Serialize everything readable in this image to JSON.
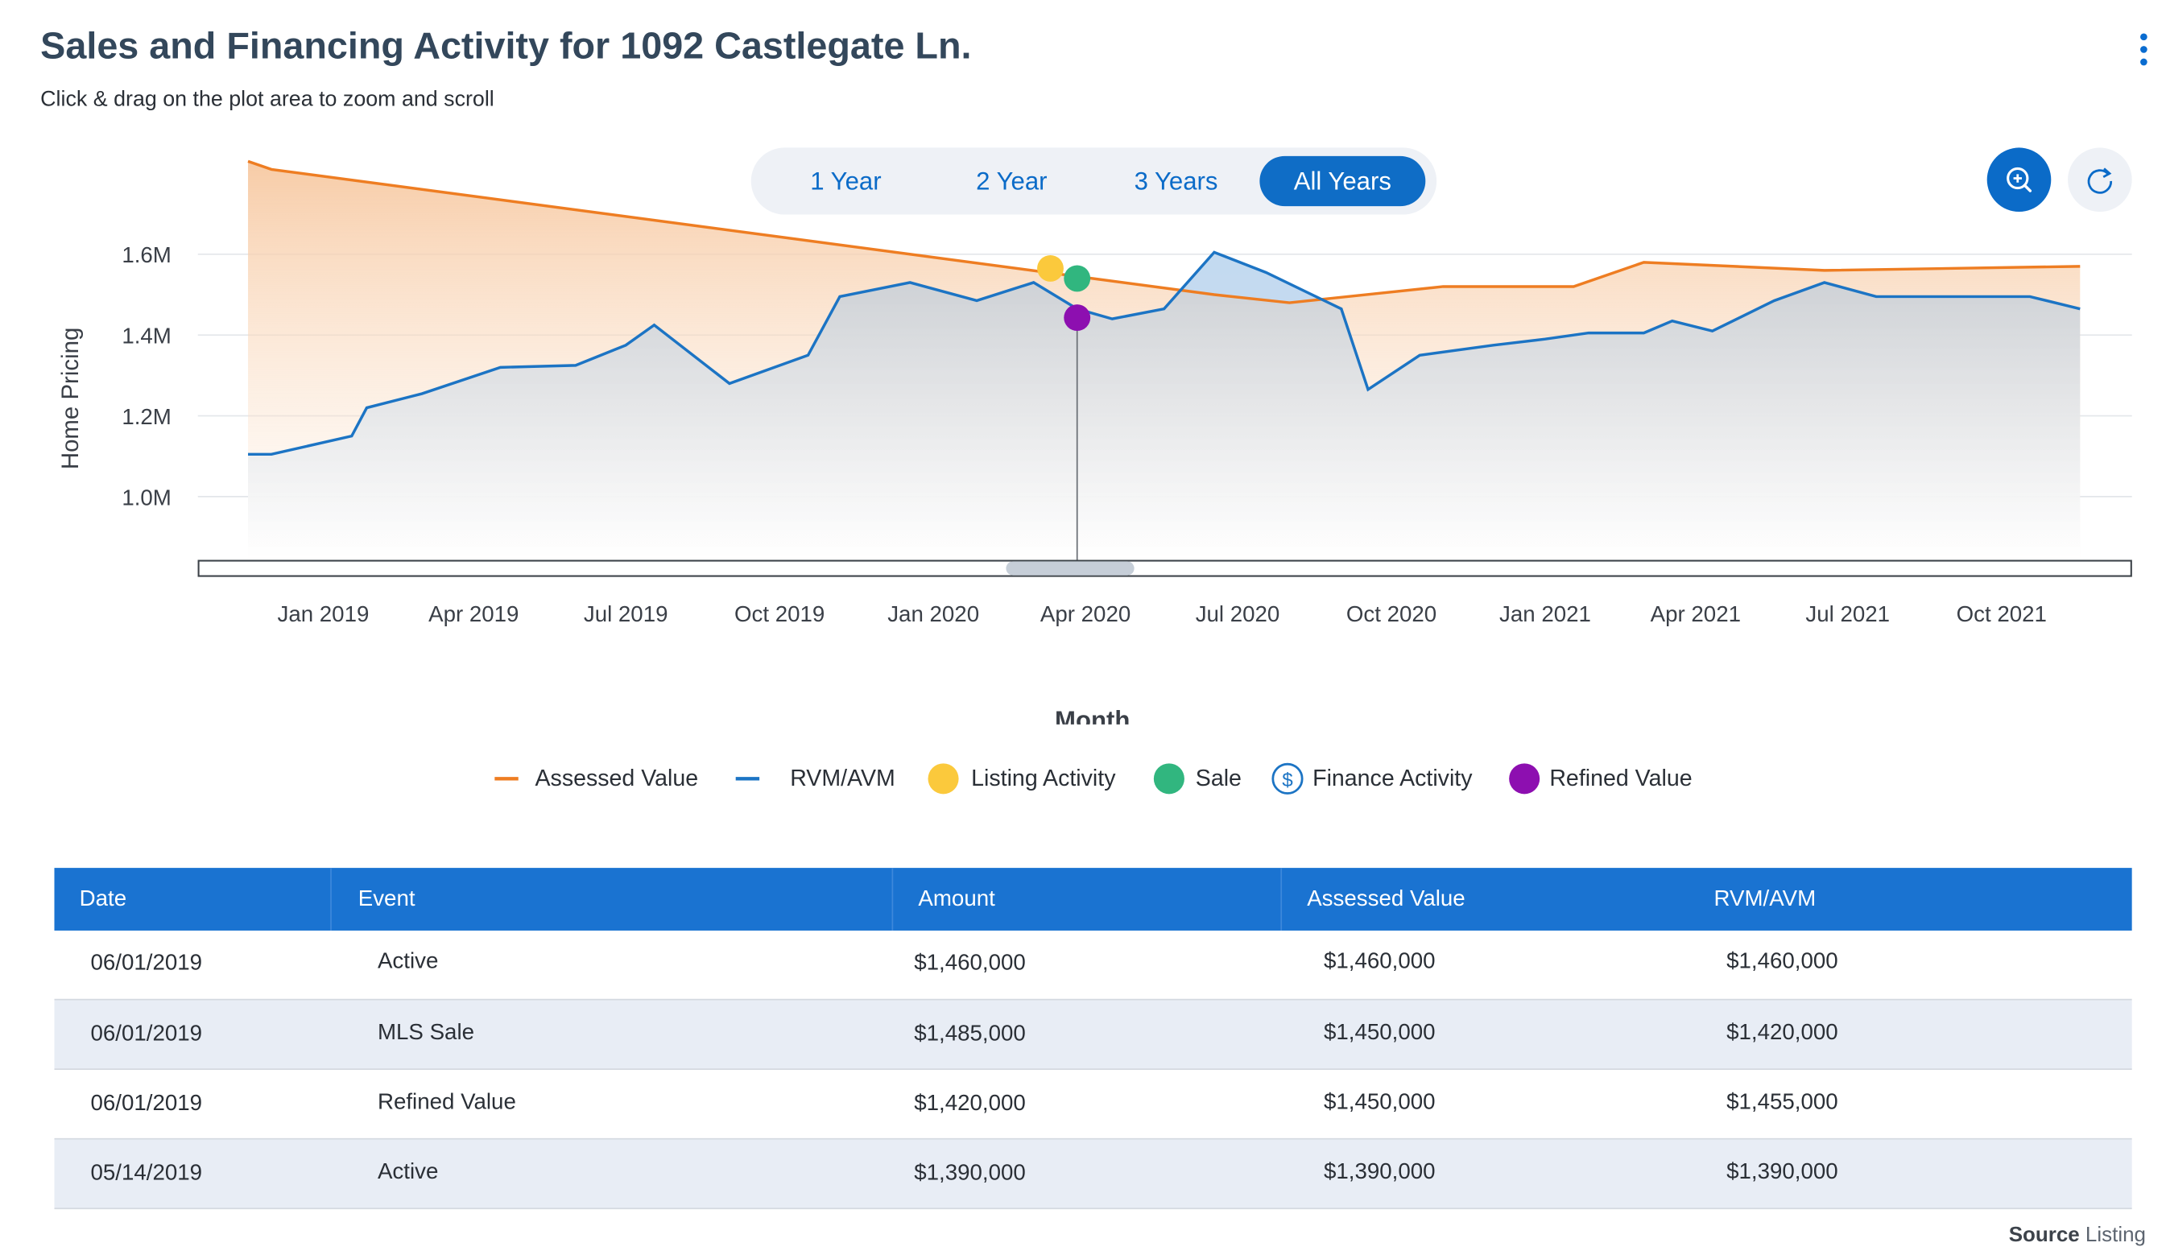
{
  "header": {
    "title": "Sales and Financing Activity for 1092 Castlegate Ln.",
    "subtitle": "Click & drag on the plot area to zoom and scroll",
    "menu_icon": "more-vertical-icon"
  },
  "range_buttons": [
    {
      "label": "1 Year",
      "active": false
    },
    {
      "label": "2 Year",
      "active": false
    },
    {
      "label": "3 Years",
      "active": false
    },
    {
      "label": "All Years",
      "active": true
    }
  ],
  "tools": {
    "zoom_icon": "zoom-in-icon",
    "reset_icon": "reset-icon"
  },
  "colors": {
    "assessed": "#ee7d22",
    "rvm": "#1c74c4",
    "listing": "#fbc93c",
    "sale": "#31b67f",
    "finance": "#1c74c4",
    "refined": "#8d0fb0",
    "table_header": "#1a73d1",
    "accent": "#0b6bc8"
  },
  "chart_data": {
    "type": "line",
    "xlabel": "Month",
    "ylabel": "Home Pricing",
    "x_ticks": [
      "Jan 2019",
      "Apr 2019",
      "Jul 2019",
      "Oct 2019",
      "Jan 2020",
      "Apr 2020",
      "Jul 2020",
      "Oct 2020",
      "Jan 2021",
      "Apr 2021",
      "Jul 2021",
      "Oct 2021"
    ],
    "y_ticks": [
      "1.0M",
      "1.2M",
      "1.4M",
      "1.6M"
    ],
    "y_tick_values": [
      1000000,
      1200000,
      1400000,
      1600000
    ],
    "ylim": [
      850000,
      1850000
    ],
    "xlim": [
      "2018-11-01",
      "2022-01-01"
    ],
    "grid": true,
    "series": [
      {
        "name": "Assessed Value",
        "x": [
          "2018-12-01",
          "2018-12-15",
          "2020-07-01",
          "2020-08-15",
          "2020-11-15",
          "2021-02-01",
          "2021-03-15",
          "2021-07-01",
          "2021-12-01"
        ],
        "values": [
          1830000,
          1810000,
          1500000,
          1480000,
          1520000,
          1520000,
          1580000,
          1560000,
          1570000
        ]
      },
      {
        "name": "RVM/AVM",
        "x": [
          "2018-12-01",
          "2018-12-15",
          "2019-02-01",
          "2019-02-10",
          "2019-03-15",
          "2019-05-01",
          "2019-06-15",
          "2019-07-15",
          "2019-08-01",
          "2019-09-15",
          "2019-11-01",
          "2019-11-20",
          "2020-01-01",
          "2020-02-10",
          "2020-03-15",
          "2020-04-10",
          "2020-05-01",
          "2020-06-01",
          "2020-07-01",
          "2020-08-01",
          "2020-09-15",
          "2020-10-01",
          "2020-11-01",
          "2020-12-15",
          "2021-01-15",
          "2021-02-10",
          "2021-03-15",
          "2021-04-01",
          "2021-04-25",
          "2021-06-01",
          "2021-07-01",
          "2021-08-01",
          "2021-11-01",
          "2021-12-01"
        ],
        "values": [
          1105000,
          1105000,
          1150000,
          1220000,
          1255000,
          1320000,
          1325000,
          1375000,
          1425000,
          1280000,
          1350000,
          1495000,
          1530000,
          1485000,
          1530000,
          1465000,
          1440000,
          1465000,
          1605000,
          1555000,
          1465000,
          1265000,
          1350000,
          1375000,
          1390000,
          1405000,
          1405000,
          1435000,
          1410000,
          1485000,
          1530000,
          1495000,
          1495000,
          1465000
        ]
      }
    ],
    "events": [
      {
        "name": "Listing Activity",
        "x": "2020-03-25",
        "y": 1565000
      },
      {
        "name": "Sale",
        "x": "2020-04-10",
        "y": 1540000
      },
      {
        "name": "Refined Value",
        "x": "2020-04-10",
        "y": 1443000
      }
    ],
    "crosshair_x": "2020-04-10",
    "legend": [
      "Assessed Value",
      "RVM/AVM",
      "Listing Activity",
      "Sale",
      "Finance Activity",
      "Refined Value"
    ],
    "legend_position": "bottom"
  },
  "table": {
    "headers": [
      "Date",
      "Event",
      "Amount",
      "Assessed Value",
      "RVM/AVM"
    ],
    "rows": [
      [
        "06/01/2019",
        "Active",
        "$1,460,000",
        "$1,460,000",
        "$1,460,000"
      ],
      [
        "06/01/2019",
        "MLS Sale",
        "$1,485,000",
        "$1,450,000",
        "$1,420,000"
      ],
      [
        "06/01/2019",
        "Refined Value",
        "$1,420,000",
        "$1,450,000",
        "$1,455,000"
      ],
      [
        "05/14/2019",
        "Active",
        "$1,390,000",
        "$1,390,000",
        "$1,390,000"
      ]
    ]
  },
  "footer": {
    "source_label": "Source",
    "source_value": "Listing"
  }
}
